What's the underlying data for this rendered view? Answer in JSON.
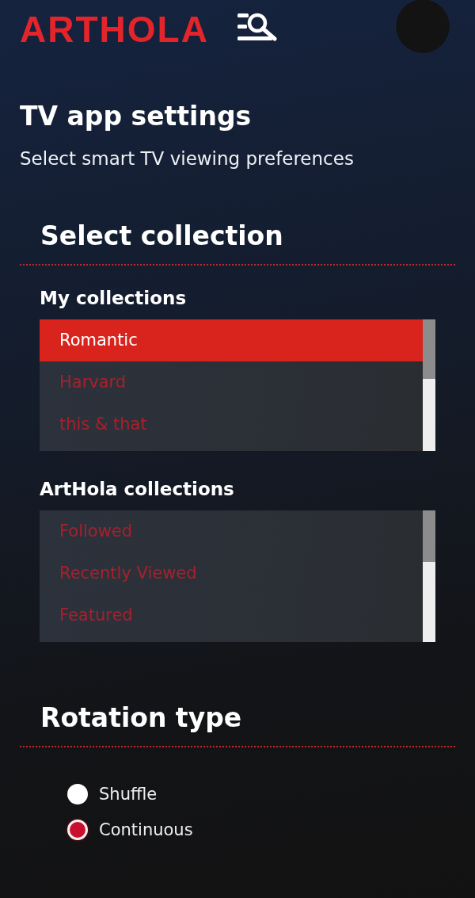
{
  "header": {
    "logo": "ARTHOLA"
  },
  "page": {
    "title": "TV app settings",
    "subtitle": "Select smart TV viewing preferences"
  },
  "select_collection": {
    "heading": "Select collection",
    "lists": [
      {
        "label": "My collections",
        "items": [
          {
            "label": "Romantic",
            "selected": true
          },
          {
            "label": "Harvard",
            "selected": false
          },
          {
            "label": "this & that",
            "selected": false
          }
        ]
      },
      {
        "label": "ArtHola collections",
        "items": [
          {
            "label": "Followed",
            "selected": false
          },
          {
            "label": "Recently Viewed",
            "selected": false
          },
          {
            "label": "Featured",
            "selected": false
          }
        ]
      }
    ]
  },
  "rotation_type": {
    "heading": "Rotation type",
    "options": [
      {
        "label": "Shuffle",
        "selected": false
      },
      {
        "label": "Continuous",
        "selected": true
      }
    ]
  }
}
